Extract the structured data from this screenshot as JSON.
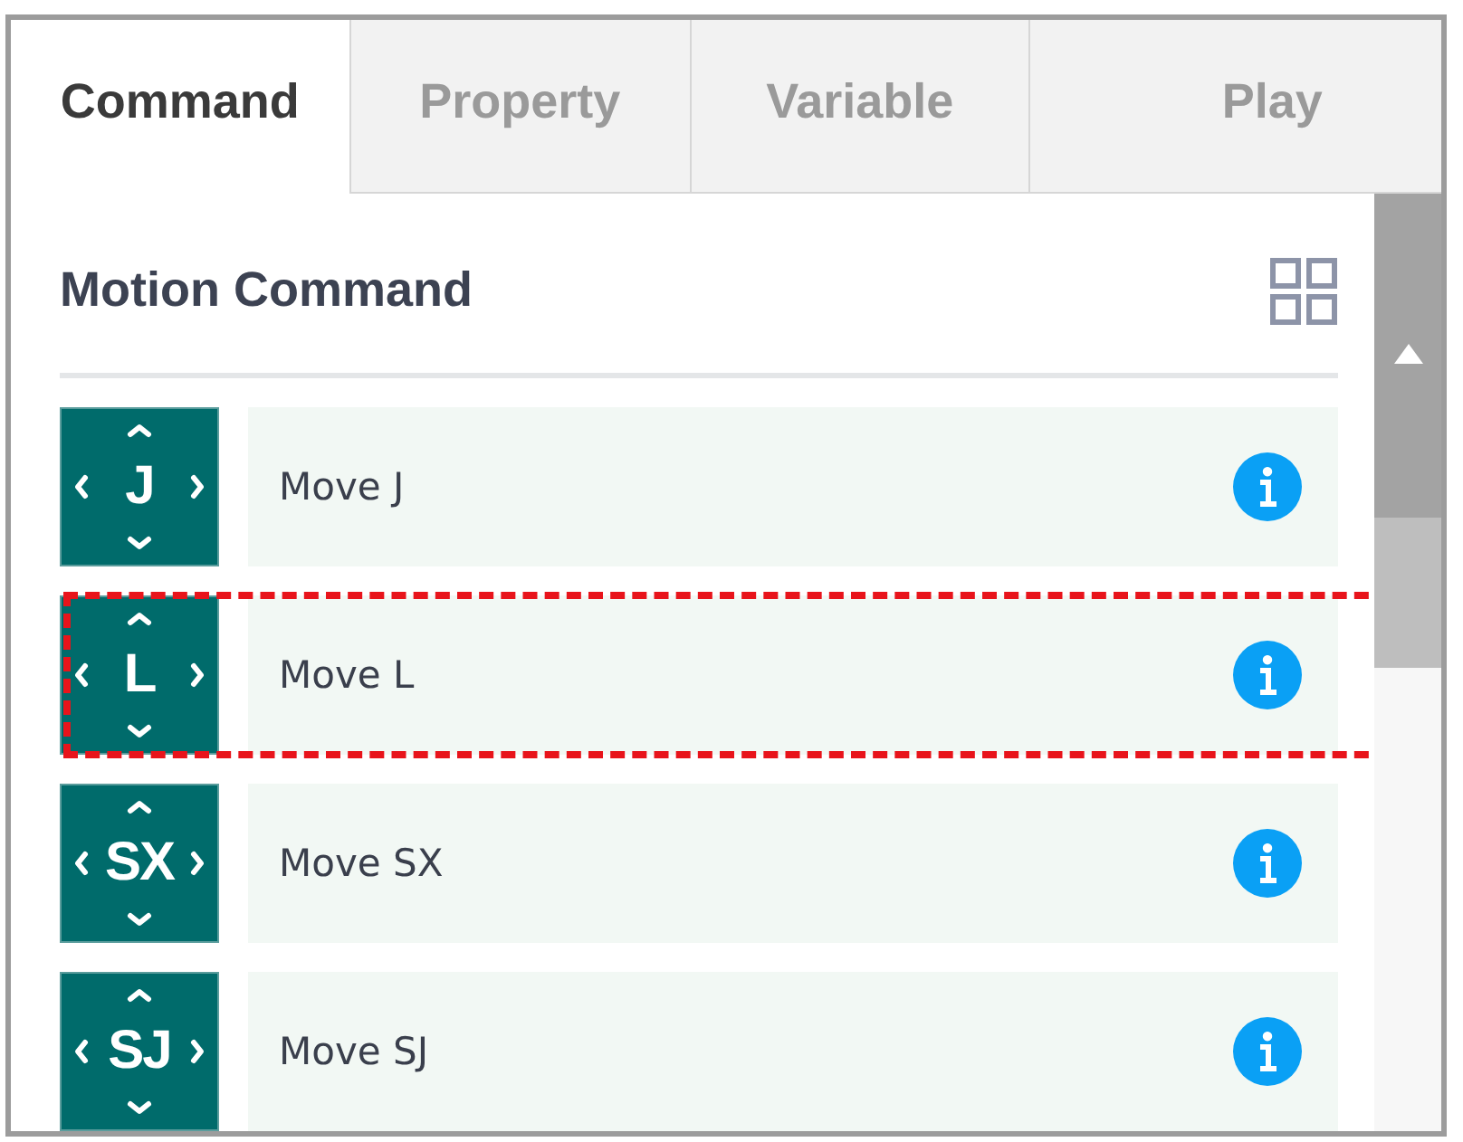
{
  "tabs": [
    {
      "label": "Command",
      "selected": true
    },
    {
      "label": "Property",
      "selected": false
    },
    {
      "label": "Variable",
      "selected": false
    },
    {
      "label": "Play",
      "selected": false
    }
  ],
  "section": {
    "title": "Motion Command"
  },
  "commands": [
    {
      "icon_label": "J",
      "label": "Move J",
      "highlighted": false
    },
    {
      "icon_label": "L",
      "label": "Move L",
      "highlighted": true
    },
    {
      "icon_label": "SX",
      "label": "Move SX",
      "highlighted": false
    },
    {
      "icon_label": "SJ",
      "label": "Move SJ",
      "highlighted": false
    }
  ]
}
